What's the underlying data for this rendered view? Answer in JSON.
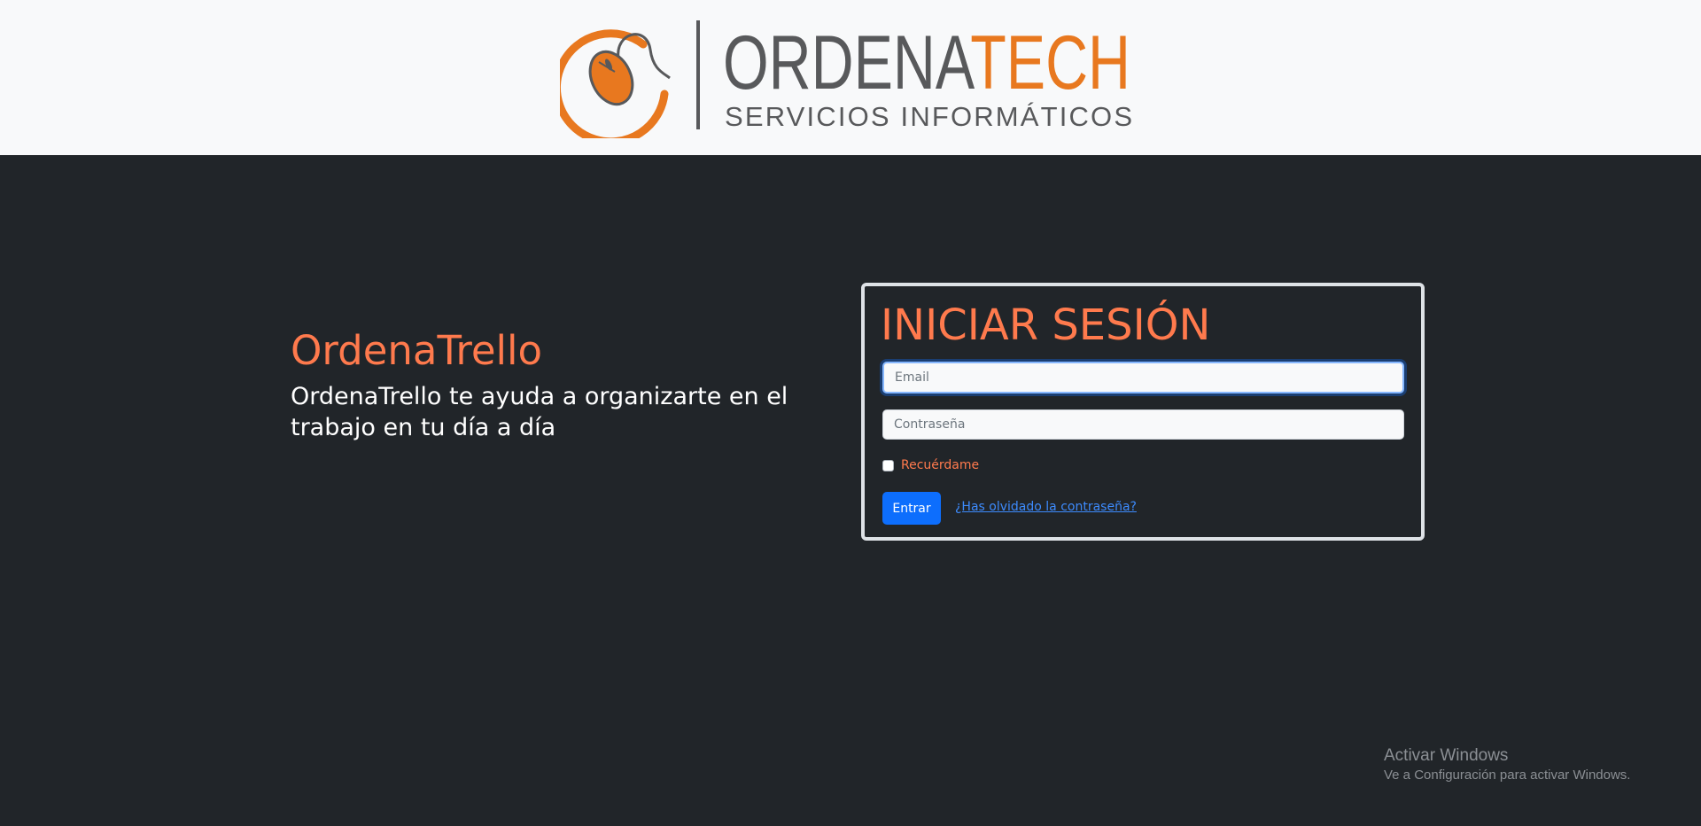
{
  "header": {
    "logo": {
      "icon": "mouse-at-icon",
      "word_1": "ORDENA",
      "word_2": "TECH",
      "tagline": "SERVICIOS INFORMÁTICOS",
      "colors": {
        "orange": "#e8781f",
        "gray": "#58595b"
      }
    }
  },
  "intro": {
    "title": "OrdenaTrello",
    "description": "OrdenaTrello te ayuda a organizarte en el trabajo en tu día a día"
  },
  "login": {
    "title": "INICIAR SESIÓN",
    "email_placeholder": "Email",
    "email_value": "",
    "password_placeholder": "Contraseña",
    "password_value": "",
    "remember_label": "Recuérdame",
    "remember_checked": false,
    "submit_label": "Entrar",
    "forgot_label": "¿Has olvidado la contraseña?"
  },
  "watermark": {
    "title": "Activar Windows",
    "subtitle": "Ve a Configuración para activar Windows."
  },
  "colors": {
    "background": "#212529",
    "header_bg": "#f8f9fa",
    "accent": "#ff7a4d",
    "primary": "#0d6efd",
    "link": "#3d8bfd"
  }
}
